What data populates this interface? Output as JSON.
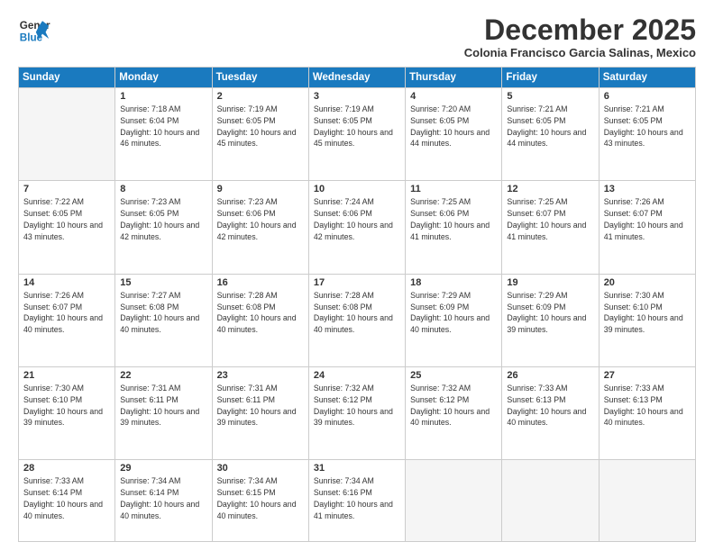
{
  "header": {
    "logo_line1": "General",
    "logo_line2": "Blue",
    "month_year": "December 2025",
    "location": "Colonia Francisco Garcia Salinas, Mexico"
  },
  "weekdays": [
    "Sunday",
    "Monday",
    "Tuesday",
    "Wednesday",
    "Thursday",
    "Friday",
    "Saturday"
  ],
  "weeks": [
    [
      {
        "day": "",
        "empty": true
      },
      {
        "day": "1",
        "sunrise": "7:18 AM",
        "sunset": "6:04 PM",
        "daylight": "10 hours and 46 minutes."
      },
      {
        "day": "2",
        "sunrise": "7:19 AM",
        "sunset": "6:05 PM",
        "daylight": "10 hours and 45 minutes."
      },
      {
        "day": "3",
        "sunrise": "7:19 AM",
        "sunset": "6:05 PM",
        "daylight": "10 hours and 45 minutes."
      },
      {
        "day": "4",
        "sunrise": "7:20 AM",
        "sunset": "6:05 PM",
        "daylight": "10 hours and 44 minutes."
      },
      {
        "day": "5",
        "sunrise": "7:21 AM",
        "sunset": "6:05 PM",
        "daylight": "10 hours and 44 minutes."
      },
      {
        "day": "6",
        "sunrise": "7:21 AM",
        "sunset": "6:05 PM",
        "daylight": "10 hours and 43 minutes."
      }
    ],
    [
      {
        "day": "7",
        "sunrise": "7:22 AM",
        "sunset": "6:05 PM",
        "daylight": "10 hours and 43 minutes."
      },
      {
        "day": "8",
        "sunrise": "7:23 AM",
        "sunset": "6:05 PM",
        "daylight": "10 hours and 42 minutes."
      },
      {
        "day": "9",
        "sunrise": "7:23 AM",
        "sunset": "6:06 PM",
        "daylight": "10 hours and 42 minutes."
      },
      {
        "day": "10",
        "sunrise": "7:24 AM",
        "sunset": "6:06 PM",
        "daylight": "10 hours and 42 minutes."
      },
      {
        "day": "11",
        "sunrise": "7:25 AM",
        "sunset": "6:06 PM",
        "daylight": "10 hours and 41 minutes."
      },
      {
        "day": "12",
        "sunrise": "7:25 AM",
        "sunset": "6:07 PM",
        "daylight": "10 hours and 41 minutes."
      },
      {
        "day": "13",
        "sunrise": "7:26 AM",
        "sunset": "6:07 PM",
        "daylight": "10 hours and 41 minutes."
      }
    ],
    [
      {
        "day": "14",
        "sunrise": "7:26 AM",
        "sunset": "6:07 PM",
        "daylight": "10 hours and 40 minutes."
      },
      {
        "day": "15",
        "sunrise": "7:27 AM",
        "sunset": "6:08 PM",
        "daylight": "10 hours and 40 minutes."
      },
      {
        "day": "16",
        "sunrise": "7:28 AM",
        "sunset": "6:08 PM",
        "daylight": "10 hours and 40 minutes."
      },
      {
        "day": "17",
        "sunrise": "7:28 AM",
        "sunset": "6:08 PM",
        "daylight": "10 hours and 40 minutes."
      },
      {
        "day": "18",
        "sunrise": "7:29 AM",
        "sunset": "6:09 PM",
        "daylight": "10 hours and 40 minutes."
      },
      {
        "day": "19",
        "sunrise": "7:29 AM",
        "sunset": "6:09 PM",
        "daylight": "10 hours and 39 minutes."
      },
      {
        "day": "20",
        "sunrise": "7:30 AM",
        "sunset": "6:10 PM",
        "daylight": "10 hours and 39 minutes."
      }
    ],
    [
      {
        "day": "21",
        "sunrise": "7:30 AM",
        "sunset": "6:10 PM",
        "daylight": "10 hours and 39 minutes."
      },
      {
        "day": "22",
        "sunrise": "7:31 AM",
        "sunset": "6:11 PM",
        "daylight": "10 hours and 39 minutes."
      },
      {
        "day": "23",
        "sunrise": "7:31 AM",
        "sunset": "6:11 PM",
        "daylight": "10 hours and 39 minutes."
      },
      {
        "day": "24",
        "sunrise": "7:32 AM",
        "sunset": "6:12 PM",
        "daylight": "10 hours and 39 minutes."
      },
      {
        "day": "25",
        "sunrise": "7:32 AM",
        "sunset": "6:12 PM",
        "daylight": "10 hours and 40 minutes."
      },
      {
        "day": "26",
        "sunrise": "7:33 AM",
        "sunset": "6:13 PM",
        "daylight": "10 hours and 40 minutes."
      },
      {
        "day": "27",
        "sunrise": "7:33 AM",
        "sunset": "6:13 PM",
        "daylight": "10 hours and 40 minutes."
      }
    ],
    [
      {
        "day": "28",
        "sunrise": "7:33 AM",
        "sunset": "6:14 PM",
        "daylight": "10 hours and 40 minutes."
      },
      {
        "day": "29",
        "sunrise": "7:34 AM",
        "sunset": "6:14 PM",
        "daylight": "10 hours and 40 minutes."
      },
      {
        "day": "30",
        "sunrise": "7:34 AM",
        "sunset": "6:15 PM",
        "daylight": "10 hours and 40 minutes."
      },
      {
        "day": "31",
        "sunrise": "7:34 AM",
        "sunset": "6:16 PM",
        "daylight": "10 hours and 41 minutes."
      },
      {
        "day": "",
        "empty": true
      },
      {
        "day": "",
        "empty": true
      },
      {
        "day": "",
        "empty": true
      }
    ]
  ]
}
